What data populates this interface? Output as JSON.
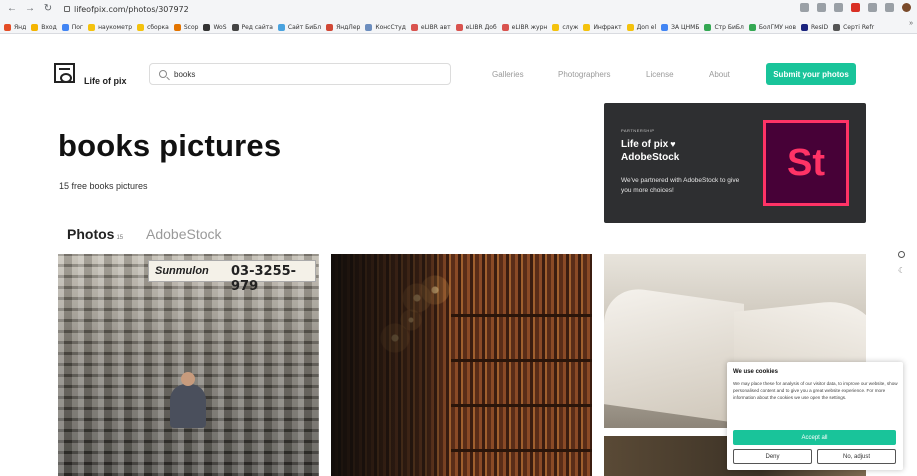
{
  "browser": {
    "url": "lifeofpix.com/photos/307972",
    "bookmarks": [
      {
        "label": "Янд",
        "color": "#e44d26"
      },
      {
        "label": "Вход",
        "color": "#f4b400"
      },
      {
        "label": "Пог",
        "color": "#4285f4"
      },
      {
        "label": "наукометр",
        "color": "#f4c20d"
      },
      {
        "label": "сборка",
        "color": "#f4c20d"
      },
      {
        "label": "Scop",
        "color": "#e37400"
      },
      {
        "label": "WoS",
        "color": "#333333"
      },
      {
        "label": "Ред сайта",
        "color": "#444444"
      },
      {
        "label": "Сайт БиБл",
        "color": "#4aa3df"
      },
      {
        "label": "ЯндЛер",
        "color": "#d14836"
      },
      {
        "label": "КонсСтуд",
        "color": "#6c8ebf"
      },
      {
        "label": "eLIBR авт",
        "color": "#d9534f"
      },
      {
        "label": "eLIBR Доб",
        "color": "#d9534f"
      },
      {
        "label": "eLIBR журн",
        "color": "#d9534f"
      },
      {
        "label": "служ",
        "color": "#f4c20d"
      },
      {
        "label": "Инфракт",
        "color": "#f4c20d"
      },
      {
        "label": "Доп el",
        "color": "#f4c20d"
      },
      {
        "label": "ЗА ЦНМБ",
        "color": "#4285f4"
      },
      {
        "label": "Стр БиБл",
        "color": "#34a853"
      },
      {
        "label": "БолГМУ нов",
        "color": "#34a853"
      },
      {
        "label": "ResID",
        "color": "#1a237e"
      },
      {
        "label": "Сертi Refr",
        "color": "#555555"
      }
    ],
    "bookmarks_more": "»"
  },
  "header": {
    "logo_text": "Life of pix",
    "search_value": "books",
    "nav": [
      "Galleries",
      "Photographers",
      "License",
      "About"
    ],
    "submit_label": "Submit your photos",
    "accent": "#19c49a"
  },
  "hero": {
    "title": "books pictures",
    "subtitle": "15 free books pictures"
  },
  "adobe_card": {
    "kicker": "PARTNERSHIP",
    "title_line1": "Life of pix",
    "title_line2": "AdobeStock",
    "heart": "♥",
    "text": "We've partnered with AdobeStock to give you more choices!",
    "logo": "St",
    "logo_color": "#ff3366"
  },
  "tabs": {
    "photos_label": "Photos",
    "photos_count": "15",
    "adobe_label": "AdobeStock"
  },
  "photos": {
    "store_sign_brand": "Sunmulon",
    "store_sign_phone": "03-3255-979"
  },
  "cookie": {
    "title": "We use cookies",
    "text": "We may place these for analysis of our visitor data, to improve our website, show personalised content and to give you a great website experience. For more information about the cookies we use open the settings.",
    "accept": "Accept all",
    "deny": "Deny",
    "adjust": "No, adjust"
  }
}
